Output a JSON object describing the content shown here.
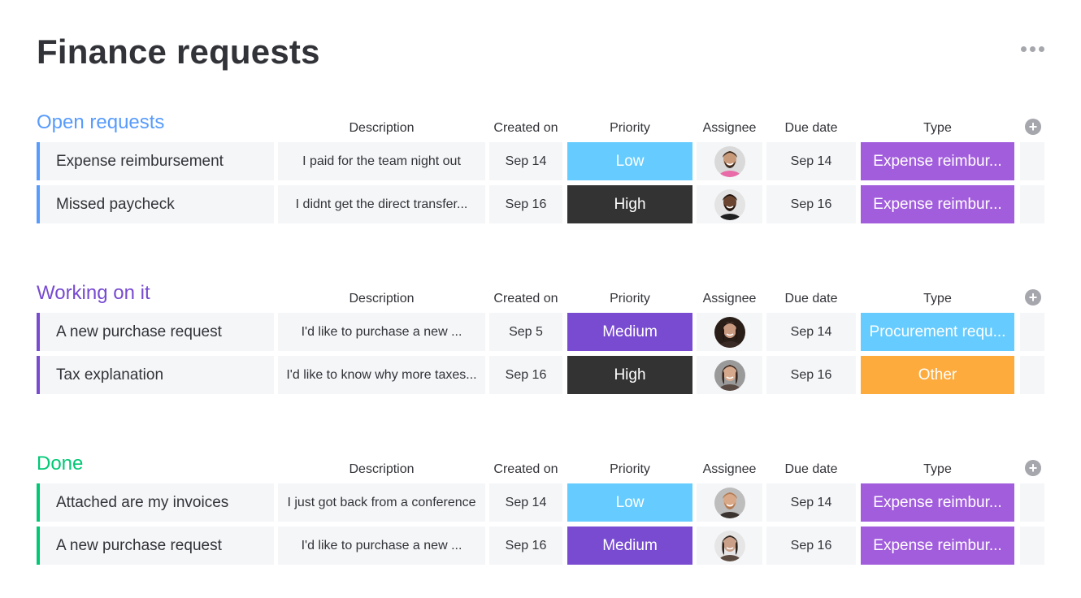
{
  "title": "Finance requests",
  "more_icon": "more-horizontal-icon",
  "columns": {
    "description": "Description",
    "created_on": "Created on",
    "priority": "Priority",
    "assignee": "Assignee",
    "due_date": "Due date",
    "type": "Type"
  },
  "add_column_icon": "plus-circle-icon",
  "colors": {
    "low": "#66ccff",
    "high": "#333333",
    "medium": "#784bd1",
    "expense": "#a25ddc",
    "procurement": "#66ccff",
    "other": "#fdab3d",
    "open": "#579bfc",
    "working": "#784bd1",
    "done": "#00c875"
  },
  "groups": [
    {
      "title": "Open requests",
      "color": "#579bfc",
      "rows": [
        {
          "name": "Expense reimbursement",
          "description": "I paid for the team night out",
          "created": "Sep 14",
          "priority": "Low",
          "priority_color": "#66ccff",
          "assignee": "bearded man in floral shirt",
          "due": "Sep 14",
          "type": "Expense reimbur...",
          "type_color": "#a25ddc"
        },
        {
          "name": "Missed paycheck",
          "description": "I didnt get the direct transfer...",
          "created": "Sep 16",
          "priority": "High",
          "priority_color": "#333333",
          "assignee": "smiling man in black shirt",
          "due": "Sep 16",
          "type": "Expense reimbur...",
          "type_color": "#a25ddc"
        }
      ]
    },
    {
      "title": "Working on it",
      "color": "#784bd1",
      "rows": [
        {
          "name": "A new purchase request",
          "description": "I'd like to purchase a new ...",
          "created": "Sep 5",
          "priority": "Medium",
          "priority_color": "#784bd1",
          "assignee": "woman with dark hair",
          "due": "Sep 14",
          "type": "Procurement requ...",
          "type_color": "#66ccff"
        },
        {
          "name": "Tax explanation",
          "description": "I'd like to know why more taxes...",
          "created": "Sep 16",
          "priority": "High",
          "priority_color": "#333333",
          "assignee": "smiling woman",
          "due": "Sep 16",
          "type": "Other",
          "type_color": "#fdab3d"
        }
      ]
    },
    {
      "title": "Done",
      "color": "#00c875",
      "rows": [
        {
          "name": "Attached are my invoices",
          "description": "I just got back from a conference",
          "created": "Sep 14",
          "priority": "Low",
          "priority_color": "#66ccff",
          "assignee": "bearded man in dark shirt",
          "due": "Sep 14",
          "type": "Expense reimbur...",
          "type_color": "#a25ddc"
        },
        {
          "name": "A new purchase request",
          "description": "I'd like to purchase a new ...",
          "created": "Sep 16",
          "priority": "Medium",
          "priority_color": "#784bd1",
          "assignee": "woman with long hair",
          "due": "Sep 16",
          "type": "Expense reimbur...",
          "type_color": "#a25ddc"
        }
      ]
    }
  ]
}
